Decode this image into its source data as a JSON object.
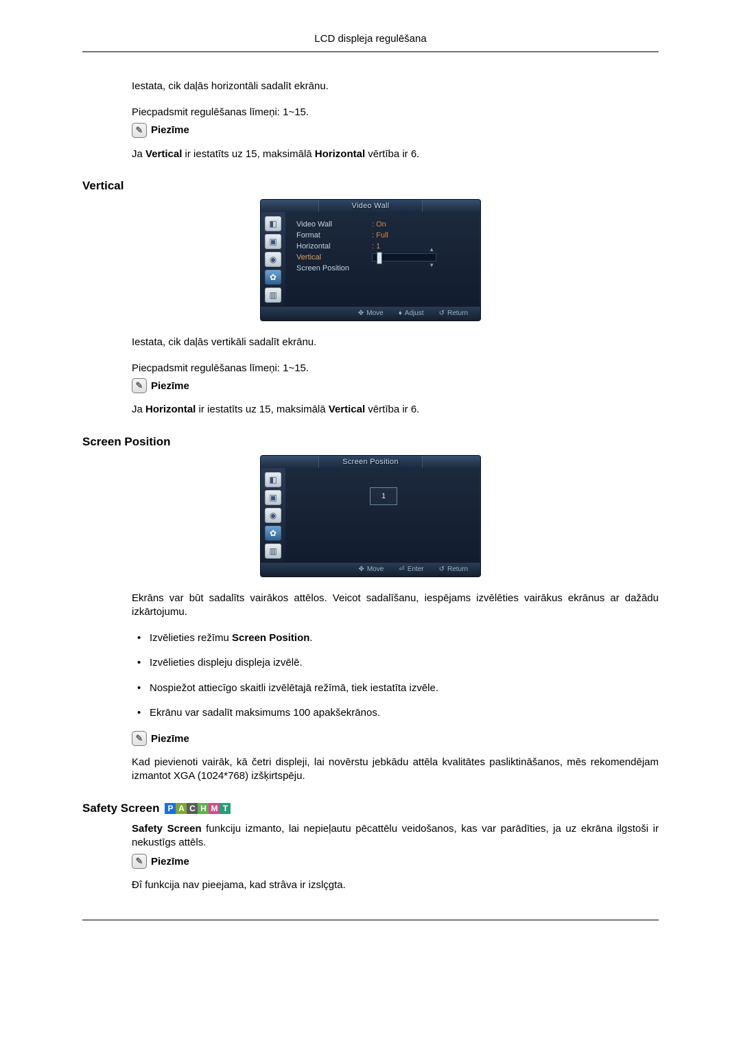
{
  "header": {
    "title": "LCD displeja regulēšana"
  },
  "intro_h": {
    "p1": "Iestata, cik daļās horizontāli sadalīt ekrānu.",
    "p2": "Piecpadsmit regulēšanas līmeņi: 1~15.",
    "note_label": "Piezīme",
    "note_prefix": "Ja ",
    "note_b1": "Vertical",
    "note_mid": " ir iestatīts uz 15, maksimālā ",
    "note_b2": "Horizontal",
    "note_suffix": " vērtība ir 6."
  },
  "vertical": {
    "title": "Vertical",
    "osd": {
      "title": "Video Wall",
      "rows": [
        {
          "label": "Video Wall",
          "value": ": On"
        },
        {
          "label": "Format",
          "value": ": Full"
        },
        {
          "label": "Horizontal",
          "value": ": 1"
        },
        {
          "label": "Vertical",
          "value": ""
        },
        {
          "label": "Screen Position",
          "value": ""
        }
      ],
      "foot_move": "Move",
      "foot_adjust": "Adjust",
      "foot_return": "Return"
    },
    "p1": "Iestata, cik daļās vertikāli sadalīt ekrānu.",
    "p2": "Piecpadsmit regulēšanas līmeņi: 1~15.",
    "note_label": "Piezīme",
    "note_prefix": "Ja ",
    "note_b1": "Horizontal",
    "note_mid": " ir iestatīts uz 15, maksimālā ",
    "note_b2": "Vertical",
    "note_suffix": " vērtība ir 6."
  },
  "screen_position": {
    "title": "Screen Position",
    "osd": {
      "title": "Screen Position",
      "cell": "1",
      "foot_move": "Move",
      "foot_enter": "Enter",
      "foot_return": "Return"
    },
    "p1": "Ekrāns var būt sadalīts vairākos attēlos. Veicot sadalīšanu, iespējams izvēlēties vairākus ekrānus ar dažādu izkārtojumu.",
    "li1_pre": "Izvēlieties režīmu ",
    "li1_b": "Screen Position",
    "li1_post": ".",
    "li2": "Izvēlieties displeju displeja izvēlē.",
    "li3": "Nospiežot attiecīgo skaitli izvēlētajā režīmā, tiek iestatīta izvēle.",
    "li4": "Ekrānu var sadalīt maksimums 100 apakšekrānos.",
    "note_label": "Piezīme",
    "note_text": "Kad pievienoti vairāk, kā četri displeji, lai novērstu jebkādu attēla kvalitātes pasliktināšanos, mēs rekomendējam izmantot XGA (1024*768) izšķirtspēju."
  },
  "safety_screen": {
    "title": "Safety Screen",
    "badges": [
      "P",
      "A",
      "C",
      "H",
      "M",
      "T"
    ],
    "p1_b": "Safety Screen",
    "p1_rest": " funkciju izmanto, lai nepieļautu pēcattēlu veidošanos, kas var parādīties, ja uz ekrāna ilgstoši ir nekustīgs attēls.",
    "note_label": "Piezīme",
    "note_text": "Ðî funkcija nav pieejama, kad strâva ir izslçgta."
  }
}
